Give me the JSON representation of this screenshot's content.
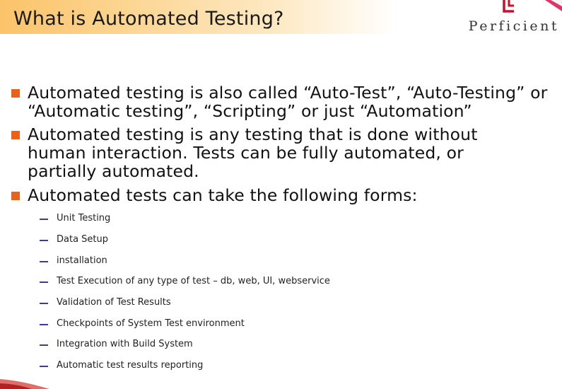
{
  "slide": {
    "title": "What is Automated Testing?",
    "logo_text": "Perficient",
    "bullets": [
      "Automated testing is also called “Auto-Test”, “Auto-Testing” or “Automatic testing”, “Scripting” or just “Automation”",
      "Automated testing is any testing that is done without human interaction. Tests can be fully automated, or partially automated.",
      "Automated tests can take the following forms:"
    ],
    "sub_bullets": [
      "Unit Testing",
      "Data Setup",
      "installation",
      "Test Execution of any type of test – db, web, UI, webservice",
      "Validation of Test Results",
      "Checkpoints of System Test environment",
      "Integration with Build System",
      "Automatic test results reporting"
    ]
  },
  "colors": {
    "accent": "#e8621c",
    "dash": "#3a3d9a",
    "title_gradient_start": "#fbc36a"
  }
}
